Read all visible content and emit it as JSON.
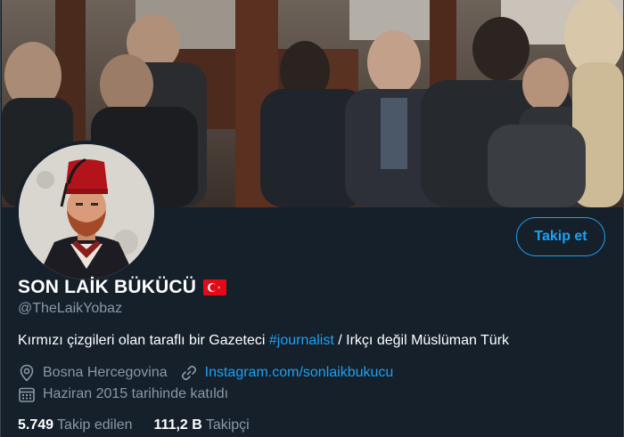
{
  "profile": {
    "display_name": "SON LAİK BÜKÜCÜ",
    "flag_icon": "turkey-flag-icon",
    "handle": "@TheLaikYobaz",
    "bio": {
      "part1": "Kırmızı çizgileri olan taraflı bir Gazeteci ",
      "hashtag": "#journalist",
      "part2": " / Irkçı değil Müslüman Türk"
    },
    "location": "Bosna Hercegovina",
    "link": "Instagram.com/sonlaikbukucu",
    "joined": "Haziran 2015 tarihinde katıldı"
  },
  "actions": {
    "follow_label": "Takip et"
  },
  "stats": {
    "following_count": "5.749",
    "following_label": "Takip edilen",
    "followers_count": "111,2 B",
    "followers_label": "Takipçi"
  },
  "icons": {
    "location": "location-pin-icon",
    "link": "link-icon",
    "calendar": "calendar-icon"
  },
  "colors": {
    "background": "#15202b",
    "accent": "#1da1f2",
    "secondary_text": "#8899a6",
    "flag_red": "#e30a17"
  }
}
